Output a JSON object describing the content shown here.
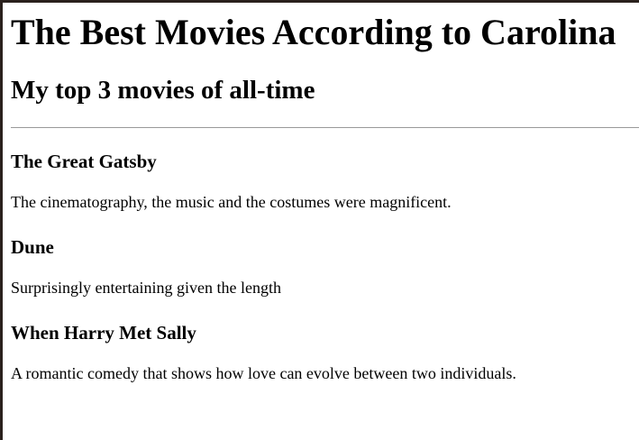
{
  "page": {
    "title": "The Best Movies According to Carolina",
    "subtitle": "My top 3 movies of all-time"
  },
  "movies": [
    {
      "title": "The Great Gatsby",
      "review": "The cinematography, the music and the costumes were magnificent."
    },
    {
      "title": "Dune",
      "review": "Surprisingly entertaining given the length"
    },
    {
      "title": "When Harry Met Sally",
      "review": "A romantic comedy that shows how love can evolve between two individuals."
    }
  ]
}
